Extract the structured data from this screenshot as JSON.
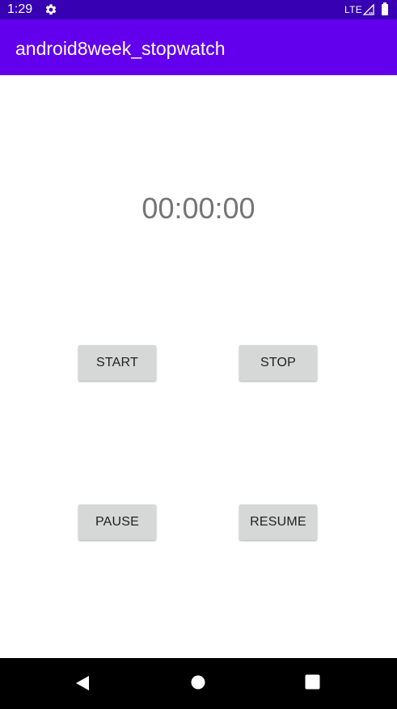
{
  "status_bar": {
    "time": "1:29",
    "network": "LTE",
    "icons": [
      "gear-icon",
      "signal-icon",
      "battery-icon"
    ]
  },
  "app_bar": {
    "title": "android8week_stopwatch"
  },
  "timer": {
    "display": "00:00:00"
  },
  "buttons": {
    "start": "START",
    "stop": "STOP",
    "pause": "PAUSE",
    "resume": "RESUME"
  },
  "nav_bar": {
    "icons": [
      "back-icon",
      "home-icon",
      "recents-icon"
    ]
  },
  "colors": {
    "status_bar": "#3700b3",
    "app_bar": "#6200ee",
    "button_bg": "#d6d7d7",
    "timer_text": "#757575",
    "nav_bar": "#000000"
  }
}
